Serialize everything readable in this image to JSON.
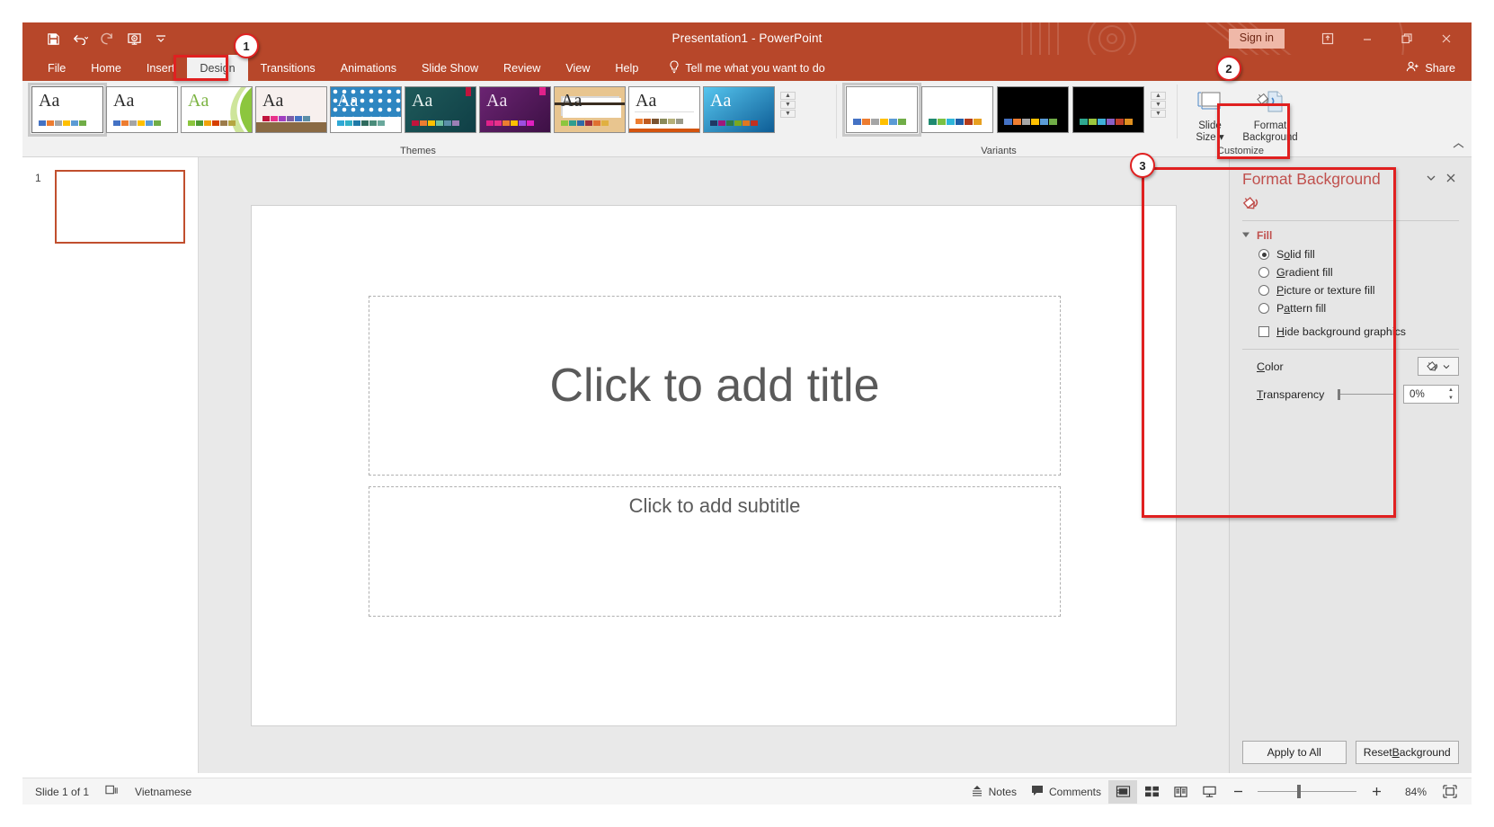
{
  "window": {
    "title": "Presentation1  -  PowerPoint",
    "signin_label": "Sign in",
    "share_label": "Share",
    "ribbon_display_icon": "ribbon-display-options-icon",
    "minimize_icon": "minimize-icon",
    "restore_icon": "restore-icon",
    "close_icon": "close-icon"
  },
  "quick_access": [
    {
      "name": "save",
      "icon": "save-icon"
    },
    {
      "name": "undo",
      "icon": "undo-icon"
    },
    {
      "name": "redo",
      "icon": "redo-icon"
    },
    {
      "name": "start-from-beginning",
      "icon": "start-slideshow-icon"
    },
    {
      "name": "customize-quick-access-toolbar",
      "icon": "chevron-down-icon"
    }
  ],
  "tabs": [
    {
      "label": "File",
      "active": false
    },
    {
      "label": "Home",
      "active": false
    },
    {
      "label": "Insert",
      "active": false
    },
    {
      "label": "Design",
      "active": true
    },
    {
      "label": "Transitions",
      "active": false
    },
    {
      "label": "Animations",
      "active": false
    },
    {
      "label": "Slide Show",
      "active": false
    },
    {
      "label": "Review",
      "active": false
    },
    {
      "label": "View",
      "active": false
    },
    {
      "label": "Help",
      "active": false
    }
  ],
  "tell_me": {
    "label": "Tell me what you want to do",
    "icon": "lightbulb-icon"
  },
  "ribbon": {
    "themes": {
      "group_label": "Themes",
      "items": [
        {
          "name": "office-theme",
          "selected": true,
          "bg": "#ffffff",
          "aa_color": "#2b2b2b",
          "swatches": [
            "#4472c4",
            "#ed7d31",
            "#a5a5a5",
            "#ffc000",
            "#5b9bd5",
            "#70ad47"
          ]
        },
        {
          "name": "facet-theme",
          "selected": false,
          "bg": "#ffffff",
          "aa_color": "#2b2b2b",
          "swatches": [
            "#4472c4",
            "#ed7d31",
            "#a5a5a5",
            "#ffc000",
            "#5b9bd5",
            "#70ad47"
          ]
        },
        {
          "name": "green-swoosh-theme",
          "selected": false,
          "bg": "#ffffff",
          "aa_color": "#7cb342",
          "swatches": [
            "#8cc63e",
            "#4e9a33",
            "#f0a30a",
            "#d64000",
            "#9c7b4a",
            "#b5a642"
          ]
        },
        {
          "name": "wisp-theme",
          "selected": false,
          "bg": "#f5ecea",
          "aa_color": "#3a3a3a",
          "swatches": [
            "#c0143c",
            "#e8318a",
            "#a040c0",
            "#7b5ea7",
            "#4472c4",
            "#5b8fa8"
          ]
        },
        {
          "name": "blue-pattern-theme",
          "selected": false,
          "bg": "#2e86c1",
          "aa_color": "#ffffff",
          "swatches": [
            "#2fa8d5",
            "#31b0c6",
            "#1f7aa8",
            "#2f6b5e",
            "#4a8c7a",
            "#6aa89c"
          ]
        },
        {
          "name": "teal-theme",
          "selected": false,
          "bg": "#1f5a5a",
          "aa_color": "#e8f2f0",
          "swatches": [
            "#c0143c",
            "#ed7d31",
            "#ffc000",
            "#6fbfa0",
            "#5b8fa8",
            "#9b7fb5"
          ]
        },
        {
          "name": "purple-theme",
          "selected": false,
          "bg": "#5b1f63",
          "aa_color": "#efe2f2",
          "swatches": [
            "#e0218a",
            "#e8318a",
            "#ed7d31",
            "#ffc000",
            "#9c4fe0",
            "#e020c0"
          ]
        },
        {
          "name": "wood-type-theme",
          "selected": false,
          "bg": "#e8c58f",
          "aa_color": "#2b2b2b",
          "swatches": [
            "#8cc63e",
            "#2f9e8f",
            "#2f6ba8",
            "#a0303a",
            "#e07030",
            "#e0b040"
          ]
        },
        {
          "name": "banded-theme",
          "selected": false,
          "bg": "#ffffff",
          "aa_color": "#2b2b2b",
          "swatches": [
            "#ed7d31",
            "#c05a20",
            "#7a5230",
            "#8a8a5a",
            "#b5b07a",
            "#9a9a8a"
          ]
        },
        {
          "name": "blue-gradient-theme",
          "selected": false,
          "bg": "#1f8fd0",
          "aa_color": "#ffffff",
          "swatches": [
            "#1f3864",
            "#a0187a",
            "#2f7a4a",
            "#7aa820",
            "#e07820",
            "#c03020"
          ]
        }
      ],
      "scroll_up_icon": "scroll-up-icon",
      "scroll_down_icon": "scroll-down-icon",
      "more_icon": "more-themes-icon"
    },
    "variants": {
      "group_label": "Variants",
      "items": [
        {
          "name": "variant-1",
          "selected": true,
          "bg": "#ffffff",
          "swatches": [
            "#4472c4",
            "#ed7d31",
            "#a5a5a5",
            "#ffc000",
            "#5b9bd5",
            "#70ad47"
          ]
        },
        {
          "name": "variant-2",
          "selected": false,
          "bg": "#ffffff",
          "swatches": [
            "#1f8a70",
            "#7ac143",
            "#2fb6d9",
            "#1f5fa8",
            "#b33a1a",
            "#e8a020"
          ]
        },
        {
          "name": "variant-3",
          "selected": false,
          "bg": "#000000",
          "swatches": [
            "#4472c4",
            "#ed7d31",
            "#a5a5a5",
            "#ffc000",
            "#5b9bd5",
            "#70ad47"
          ]
        },
        {
          "name": "variant-4",
          "selected": false,
          "bg": "#000000",
          "swatches": [
            "#2fa890",
            "#9ac63e",
            "#3fb0d9",
            "#8a5fc4",
            "#c0402a",
            "#e09020"
          ]
        }
      ],
      "scroll_up_icon": "scroll-up-icon",
      "scroll_down_icon": "scroll-down-icon",
      "more_icon": "more-variants-icon"
    },
    "customize": {
      "group_label": "Customize",
      "slide_size_label_line1": "Slide",
      "slide_size_label_line2": "Size",
      "slide_size_icon": "slide-size-icon",
      "format_background_label_line1": "Format",
      "format_background_label_line2": "Background",
      "format_background_icon": "format-background-icon"
    },
    "collapse_icon": "collapse-ribbon-icon"
  },
  "slide_panel": {
    "slide_number": "1"
  },
  "slide": {
    "title_placeholder": "Click to add title",
    "subtitle_placeholder": "Click to add subtitle"
  },
  "format_background_pane": {
    "title": "Format Background",
    "fill_icon": "paint-bucket-icon",
    "options_dropdown_icon": "chevron-down-icon",
    "close_icon": "close-icon",
    "section_label": "Fill",
    "section_expand_icon": "triangle-collapse-icon",
    "radios": [
      {
        "label_pre": "S",
        "label_key": "o",
        "label_post": "lid fill",
        "full": "Solid fill",
        "selected": true,
        "name": "solid-fill"
      },
      {
        "label_pre": "",
        "label_key": "G",
        "label_post": "radient fill",
        "full": "Gradient fill",
        "selected": false,
        "name": "gradient-fill"
      },
      {
        "label_pre": "",
        "label_key": "P",
        "label_post": "icture or texture fill",
        "full": "Picture or texture fill",
        "selected": false,
        "name": "picture-or-texture-fill"
      },
      {
        "label_pre": "P",
        "label_key": "a",
        "label_post": "ttern fill",
        "full": "Pattern fill",
        "selected": false,
        "name": "pattern-fill"
      }
    ],
    "checkbox": {
      "label_pre": "",
      "label_key": "H",
      "label_post": "ide background graphics",
      "full": "Hide background graphics",
      "checked": false
    },
    "color_label_pre": "",
    "color_label_key": "C",
    "color_label_post": "olor",
    "color_label": "Color",
    "color_button_icon": "paint-bucket-icon",
    "color_dropdown_icon": "chevron-down-icon",
    "transparency_label_pre": "",
    "transparency_label_key": "T",
    "transparency_label_post": "ransparency",
    "transparency_label": "Transparency",
    "transparency_value": "0%",
    "apply_to_all_label": "Apply to All",
    "reset_background_label_pre": "Reset ",
    "reset_background_label_key": "B",
    "reset_background_label_post": "ackground",
    "reset_background_label": "Reset Background"
  },
  "status_bar": {
    "slide_indicator": "Slide 1 of 1",
    "accessibility_icon": "accessibility-checker-icon",
    "language": "Vietnamese",
    "notes_label": "Notes",
    "notes_icon": "notes-icon",
    "comments_label": "Comments",
    "comments_icon": "comments-icon",
    "views": [
      {
        "name": "normal-view",
        "icon": "normal-view-icon",
        "active": true
      },
      {
        "name": "slide-sorter-view",
        "icon": "slide-sorter-icon",
        "active": false
      },
      {
        "name": "reading-view",
        "icon": "reading-view-icon",
        "active": false
      },
      {
        "name": "slide-show-view",
        "icon": "slide-show-icon",
        "active": false
      }
    ],
    "zoom_out_icon": "zoom-out-icon",
    "zoom_in_icon": "zoom-in-icon",
    "zoom_level": "84%",
    "fit_slide_icon": "fit-slide-to-window-icon"
  },
  "callouts": [
    {
      "number": "1",
      "target": "design-tab"
    },
    {
      "number": "2",
      "target": "format-background-button"
    },
    {
      "number": "3",
      "target": "format-background-pane"
    }
  ],
  "colors": {
    "brand": "#b7472a",
    "accent": "#c0504d",
    "callout": "#e02020"
  }
}
